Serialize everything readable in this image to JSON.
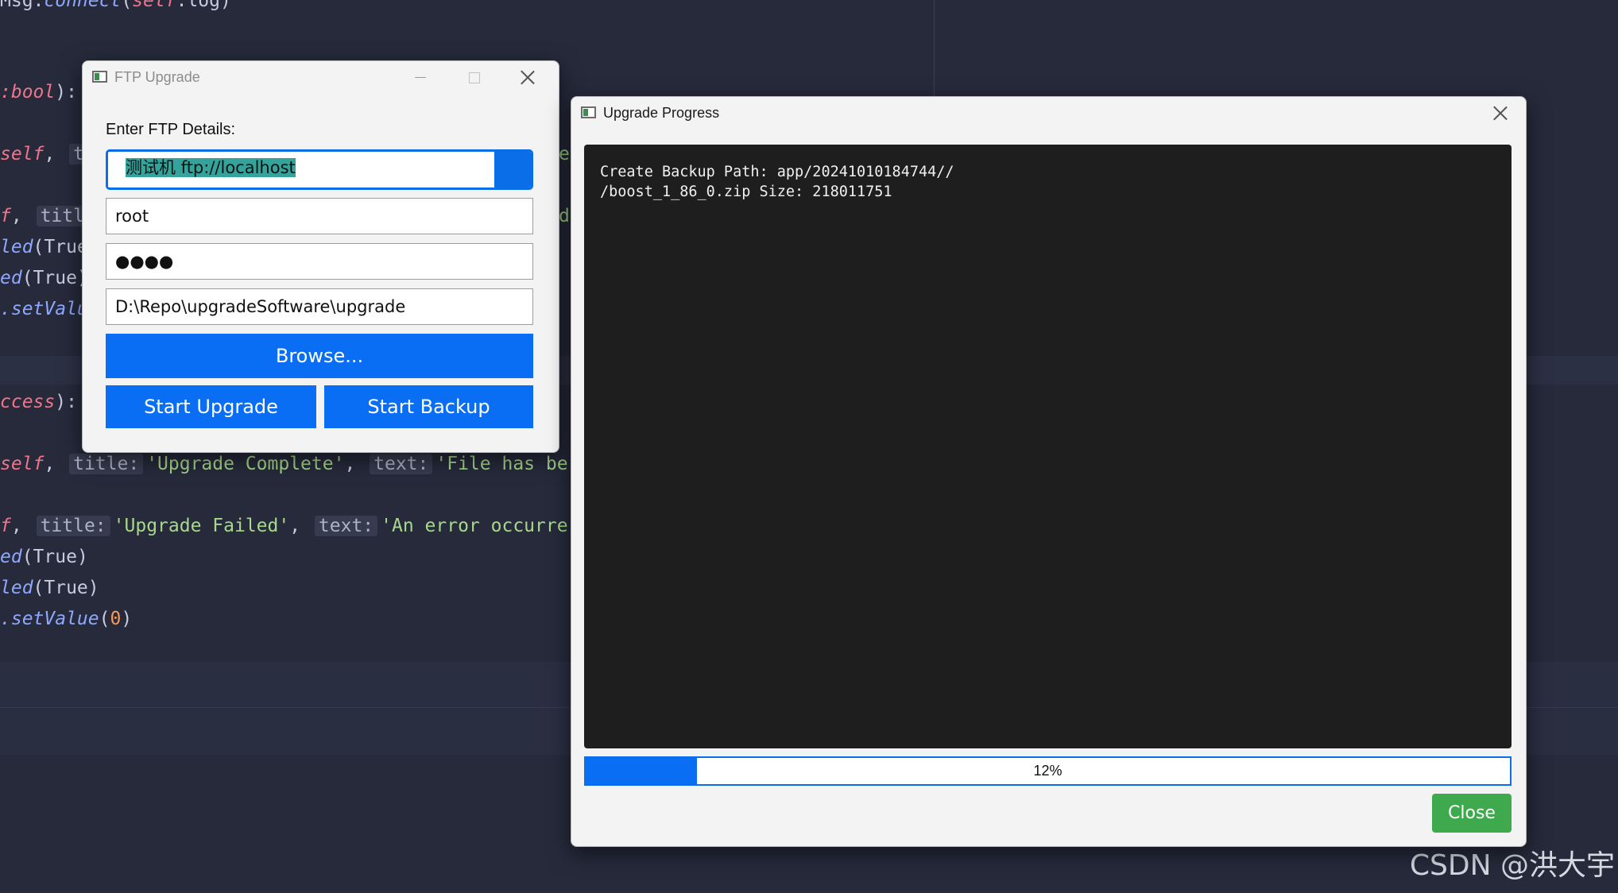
{
  "editor": {
    "lines": [
      {
        "plain": "Msg.",
        "fn": "connect",
        "rest": "(",
        "kw": "self",
        "tail": ".log)"
      },
      {
        "kw": ":bool",
        "tail": "):"
      },
      {
        "kw": "self",
        "tail": ", "
      },
      {
        "kw": "f",
        "tail": ", ",
        "hint": "titl"
      },
      {
        "fn": "led",
        "tail": "(True"
      },
      {
        "fn": "ed",
        "tail": "(True)"
      },
      {
        "fn": ".setValu",
        "tail": ""
      },
      {
        "kw": "ccess",
        "tail": "):"
      },
      {
        "kw": "self",
        "tail": ", ",
        "hint1": "title:",
        "str1": "'Upgrade Complete'",
        "sep": ", ",
        "hint2": "text:",
        "str2": "'File has be"
      },
      {
        "kw": "f",
        "tail": ", ",
        "hint1": "title:",
        "str1": "'Upgrade Failed'",
        "sep": ", ",
        "hint2": "text:",
        "str2": "'An error occurre"
      },
      {
        "fn": "ed",
        "tail": "(True)"
      },
      {
        "fn": "led",
        "tail": "(True)"
      },
      {
        "fn": ".setValue",
        "tail_open": "(",
        "num": "0",
        "tail_close": ")"
      }
    ],
    "peek_e": "e",
    "peek_d": "d",
    "peek_t": "t"
  },
  "ftp_window": {
    "title": "FTP Upgrade",
    "form_label": "Enter FTP Details:",
    "host_value": "测试机 ftp://localhost",
    "username_value": "root",
    "password_value": "●●●●",
    "path_value": "D:\\Repo\\upgradeSoftware\\upgrade",
    "browse_label": "Browse...",
    "start_upgrade_label": "Start Upgrade",
    "start_backup_label": "Start Backup"
  },
  "progress_window": {
    "title": "Upgrade Progress",
    "log_text": "Create Backup Path: app/20241010184744//\n/boost_1_86_0.zip Size: 218011751",
    "progress_percent": 12,
    "progress_label": "12%",
    "close_label": "Close"
  },
  "watermark": "CSDN @洪大宇",
  "colors": {
    "accent": "#0a6ef5",
    "close_button": "#3faa4d",
    "editor_bg": "#262a3b",
    "log_bg": "#1e1e1e"
  }
}
